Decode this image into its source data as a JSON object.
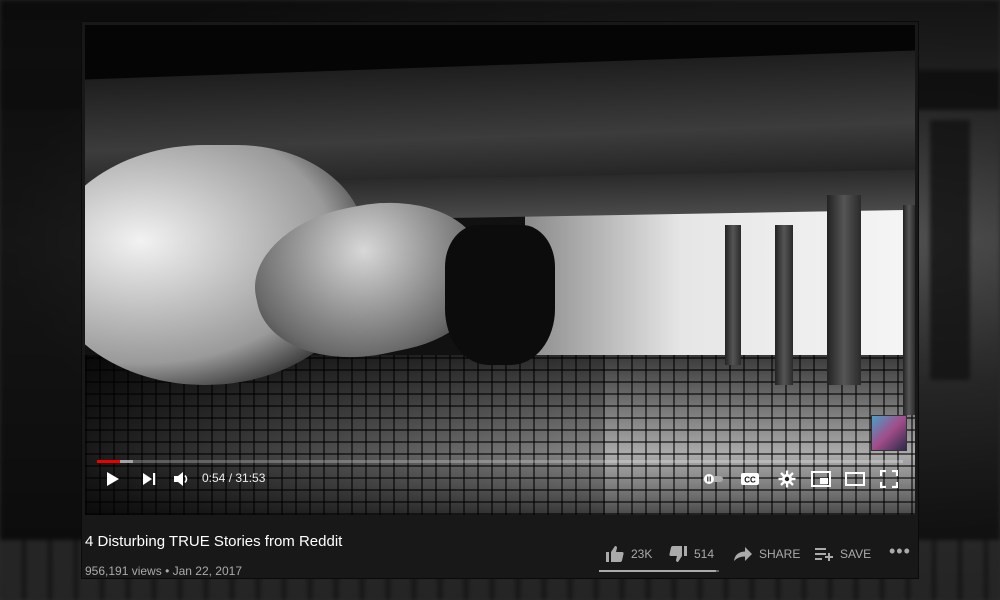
{
  "player": {
    "current_time": "0:54",
    "duration": "31:53",
    "time_display": "0:54 / 31:53",
    "progress_fraction": 0.028,
    "buffer_fraction": 0.045,
    "play_icon": "play-icon",
    "next_icon": "next-icon",
    "volume_icon": "volume-icon",
    "autoplay_icon": "autoplay-toggle-icon",
    "cc_label": "CC",
    "settings_icon": "gear-icon",
    "miniplayer_icon": "miniplayer-icon",
    "theater_icon": "theater-mode-icon",
    "fullscreen_icon": "fullscreen-icon"
  },
  "video": {
    "title": "4 Disturbing TRUE Stories from Reddit",
    "views": "956,191 views",
    "separator": "•",
    "date": "Jan 22, 2017",
    "meta_line": "956,191 views • Jan 22, 2017"
  },
  "actions": {
    "like_count": "23K",
    "dislike_count": "514",
    "share_label": "SHARE",
    "save_label": "SAVE",
    "more_label": "•••",
    "like_fraction": 0.978
  },
  "colors": {
    "accent_red": "#ee0000",
    "page_bg": "#181818",
    "text_primary": "#ffffff",
    "text_secondary": "#aaaaaa"
  }
}
